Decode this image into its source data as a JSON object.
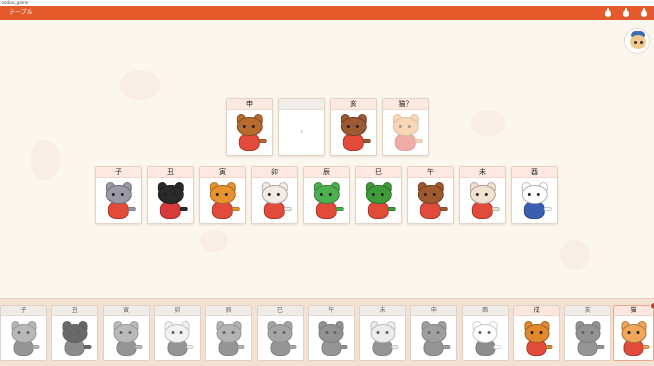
{
  "window": {
    "title": "zodiac_game"
  },
  "header": {
    "title": "テーブル",
    "accent": "#e55a2b"
  },
  "target_row": [
    {
      "label": "申",
      "animal": "monkey",
      "state": "filled"
    },
    {
      "label": "",
      "animal": "",
      "state": "empty",
      "placeholder": "?"
    },
    {
      "label": "亥",
      "animal": "boar",
      "state": "filled"
    },
    {
      "label": "猫？",
      "animal": "cat",
      "state": "faded"
    }
  ],
  "board_row": [
    {
      "label": "子",
      "animal": "rat"
    },
    {
      "label": "丑",
      "animal": "ox"
    },
    {
      "label": "寅",
      "animal": "tiger"
    },
    {
      "label": "卯",
      "animal": "rabbit"
    },
    {
      "label": "辰",
      "animal": "dragon"
    },
    {
      "label": "巳",
      "animal": "snake"
    },
    {
      "label": "午",
      "animal": "horse"
    },
    {
      "label": "未",
      "animal": "sheep"
    },
    {
      "label": "酉",
      "animal": "rooster"
    }
  ],
  "tray": [
    {
      "label": "子",
      "animal": "rat",
      "style": "gray"
    },
    {
      "label": "丑",
      "animal": "ox",
      "style": "gray"
    },
    {
      "label": "寅",
      "animal": "tiger",
      "style": "gray"
    },
    {
      "label": "卯",
      "animal": "rabbit",
      "style": "gray"
    },
    {
      "label": "辰",
      "animal": "dragon",
      "style": "gray"
    },
    {
      "label": "巳",
      "animal": "snake",
      "style": "gray"
    },
    {
      "label": "午",
      "animal": "horse",
      "style": "gray"
    },
    {
      "label": "未",
      "animal": "sheep",
      "style": "gray"
    },
    {
      "label": "申",
      "animal": "monkey",
      "style": "gray"
    },
    {
      "label": "酉",
      "animal": "rooster",
      "style": "gray"
    },
    {
      "label": "戌",
      "animal": "dog",
      "style": "color"
    },
    {
      "label": "亥",
      "animal": "boar",
      "style": "gray"
    },
    {
      "label": "猫",
      "animal": "cat",
      "style": "color"
    }
  ],
  "colors": {
    "rat": "#9a9aa6",
    "ox": "#2a2a2a",
    "tiger": "#e8932c",
    "rabbit": "#f3ece6",
    "dragon": "#4caf50",
    "snake": "#3f9b3a",
    "horse": "#a0582f",
    "sheep": "#f1e2cf",
    "rooster": "#ffffff",
    "monkey": "#b86b2d",
    "dog": "#e0892f",
    "boar": "#9b5a33",
    "cat": "#f2a65a"
  }
}
